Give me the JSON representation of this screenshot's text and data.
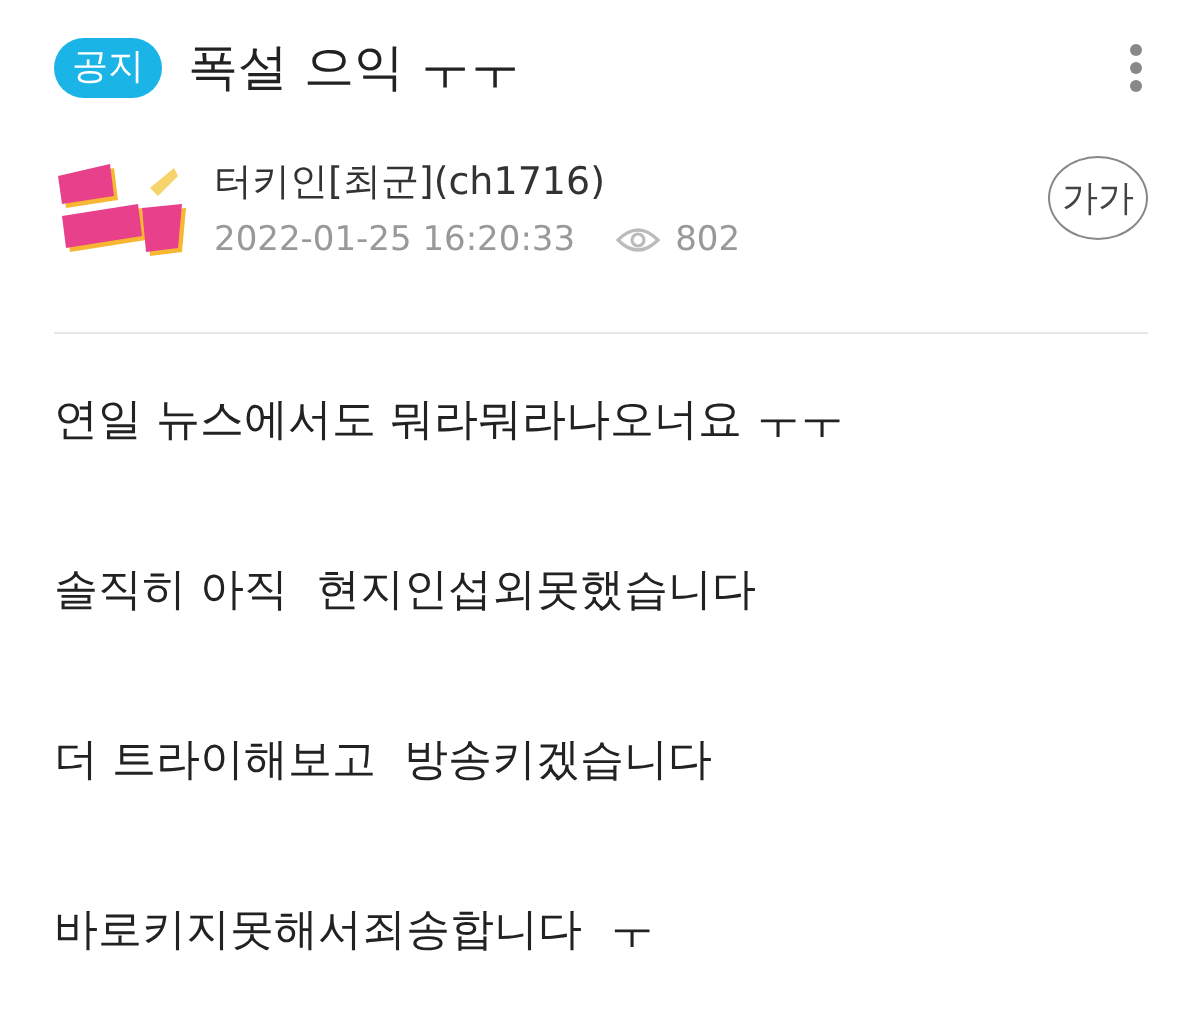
{
  "post": {
    "badge": "공지",
    "title": "폭설 으익 ㅜㅜ"
  },
  "author": {
    "name": "터키인[최군](ch1716)",
    "date": "2022-01-25 16:20:33",
    "views": "802",
    "font_button": "가가"
  },
  "body": [
    "연일 뉴스에서도 뭐라뭐라나오너요 ㅜㅜ",
    "솔직히 아직  현지인섭외못했습니다",
    "더 트라이해보고  방송키겠습니다",
    "바로키지못해서죄송합니다  ㅜ"
  ]
}
